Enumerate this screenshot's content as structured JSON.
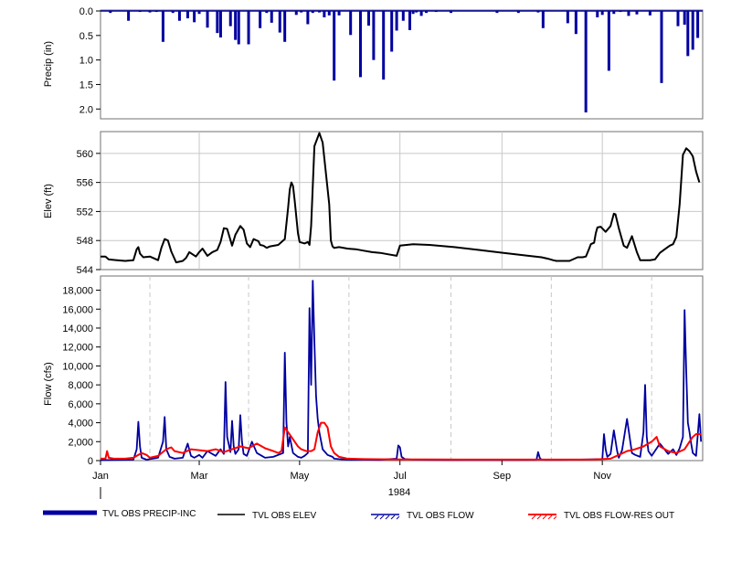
{
  "chart_data": [
    {
      "type": "bar",
      "ylabel": "Precip (in)",
      "ylim": [
        0,
        2.2
      ],
      "y_inverted": true,
      "yticks": [
        "0.0",
        "0.5",
        "1.0",
        "1.5",
        "2.0"
      ],
      "ytick_values": [
        0,
        0.5,
        1.0,
        1.5,
        2.0
      ],
      "grid": false,
      "series": [
        {
          "color": "#0000a0",
          "x_day": [
            6,
            17,
            24,
            30,
            34,
            38,
            44,
            48,
            53,
            57,
            60,
            65,
            71,
            73,
            79,
            82,
            84,
            90,
            97,
            101,
            104,
            109,
            112,
            119,
            122,
            126,
            129,
            133,
            136,
            139,
            142,
            145,
            152,
            158,
            163,
            166,
            172,
            177,
            180,
            184,
            188,
            190,
            192,
            195,
            198,
            204,
            213,
            241,
            254,
            266,
            269,
            284,
            289,
            295,
            302,
            305,
            309,
            312,
            316,
            321,
            326,
            334,
            341,
            351,
            355,
            357,
            360,
            363
          ],
          "values": [
            0.04,
            0.2,
            0.02,
            0.03,
            0.02,
            0.63,
            0.04,
            0.2,
            0.15,
            0.23,
            0.06,
            0.34,
            0.45,
            0.54,
            0.31,
            0.59,
            0.68,
            0.68,
            0.35,
            0.04,
            0.24,
            0.44,
            0.63,
            0.08,
            0.03,
            0.27,
            0.04,
            0.03,
            0.13,
            0.09,
            1.42,
            0.09,
            0.49,
            1.35,
            0.3,
            1.0,
            1.4,
            0.83,
            0.4,
            0.2,
            0.39,
            0.06,
            0.03,
            0.1,
            0.04,
            0.02,
            0.04,
            0.04,
            0.04,
            0.03,
            0.35,
            0.25,
            0.47,
            2.07,
            0.13,
            0.08,
            1.22,
            0.06,
            0.02,
            0.1,
            0.07,
            0.09,
            1.47,
            0.31,
            0.28,
            0.92,
            0.79,
            0.55
          ]
        }
      ]
    },
    {
      "type": "line",
      "ylabel": "Elev (ft)",
      "ylim": [
        544,
        563
      ],
      "yticks": [
        "544",
        "548",
        "552",
        "556",
        "560"
      ],
      "ytick_values": [
        544,
        548,
        552,
        556,
        560
      ],
      "grid": true,
      "series": [
        {
          "color": "#000000",
          "x_day": [
            0,
            3,
            5,
            10,
            15,
            20,
            22,
            23,
            24,
            26,
            30,
            35,
            37,
            39,
            41,
            43,
            46,
            50,
            52,
            54,
            58,
            60,
            62,
            65,
            68,
            71,
            73,
            75,
            77,
            80,
            82,
            85,
            87,
            89,
            91,
            93,
            96,
            97,
            99,
            101,
            103,
            108,
            112,
            114,
            115,
            116,
            117,
            118,
            120,
            121,
            124,
            126,
            127,
            128,
            130,
            133,
            135,
            139,
            140,
            141,
            142,
            145,
            150,
            155,
            160,
            165,
            170,
            175,
            180,
            182,
            190,
            200,
            215,
            230,
            245,
            260,
            268,
            272,
            275,
            277,
            280,
            285,
            290,
            293,
            295,
            297,
            298,
            300,
            301,
            302,
            304,
            307,
            310,
            312,
            313,
            315,
            318,
            320,
            323,
            326,
            328,
            330,
            332,
            334,
            337,
            340,
            343,
            346,
            348,
            350,
            352,
            354,
            356,
            358,
            360,
            362,
            364
          ],
          "values": [
            545.8,
            545.8,
            545.4,
            545.3,
            545.2,
            545.3,
            546.8,
            547.1,
            546.2,
            545.7,
            545.8,
            545.3,
            547.0,
            548.2,
            548.0,
            546.5,
            545.0,
            545.2,
            545.6,
            546.4,
            545.8,
            546.4,
            546.9,
            545.9,
            546.4,
            546.7,
            547.8,
            549.7,
            549.6,
            547.3,
            548.8,
            550.0,
            549.5,
            547.6,
            547.1,
            548.2,
            547.9,
            547.4,
            547.3,
            547.0,
            547.2,
            547.4,
            548.2,
            552.5,
            555.0,
            556.0,
            555.5,
            553.5,
            549.0,
            547.8,
            547.6,
            547.8,
            547.4,
            550.0,
            561.0,
            562.8,
            561.5,
            553.0,
            548.0,
            547.2,
            547.0,
            547.1,
            546.9,
            546.8,
            546.6,
            546.4,
            546.3,
            546.1,
            545.9,
            547.3,
            547.5,
            547.4,
            547.1,
            546.7,
            546.3,
            545.9,
            545.7,
            545.5,
            545.3,
            545.2,
            545.2,
            545.2,
            545.7,
            545.7,
            545.8,
            546.9,
            547.5,
            547.7,
            549.0,
            549.8,
            549.9,
            549.2,
            550.0,
            551.7,
            551.6,
            549.7,
            547.3,
            547.0,
            548.6,
            546.4,
            545.3,
            545.3,
            545.3,
            545.3,
            545.4,
            546.3,
            546.8,
            547.3,
            547.5,
            548.5,
            553.0,
            559.8,
            560.7,
            560.3,
            559.6,
            557.5,
            556.0
          ]
        }
      ]
    },
    {
      "type": "line",
      "xlabel": "1984",
      "ylabel": "Flow (cfs)",
      "ylim": [
        0,
        19500
      ],
      "yticks": [
        "0",
        "2,000",
        "4,000",
        "6,000",
        "8,000",
        "10,000",
        "12,000",
        "14,000",
        "16,000",
        "18,000"
      ],
      "ytick_values": [
        0,
        2000,
        4000,
        6000,
        8000,
        10000,
        12000,
        14000,
        16000,
        18000
      ],
      "xticks": [
        "Jan",
        "Mar",
        "May",
        "Jul",
        "Sep",
        "Nov"
      ],
      "xtick_days": [
        0,
        60,
        121,
        182,
        244,
        305
      ],
      "grid_days": [
        30,
        90,
        151,
        213,
        274,
        335
      ],
      "x_range_days": [
        0,
        365
      ],
      "legend_position": "bottom",
      "series": [
        {
          "name": "TVL OBS FLOW",
          "color": "#0000a0",
          "x_day": [
            0,
            20,
            22,
            23,
            24,
            25,
            28,
            35,
            38,
            39,
            40,
            42,
            45,
            50,
            53,
            55,
            57,
            60,
            62,
            65,
            70,
            73,
            75,
            76,
            77,
            79,
            80,
            81,
            82,
            84,
            85,
            86,
            87,
            89,
            92,
            95,
            98,
            100,
            105,
            111,
            112,
            113,
            114,
            115,
            117,
            120,
            122,
            124,
            126,
            127,
            128,
            129,
            130,
            131,
            132,
            133,
            135,
            138,
            141,
            142,
            145,
            150,
            160,
            170,
            180,
            181,
            182,
            183,
            185,
            190,
            200,
            210,
            220,
            230,
            240,
            265,
            266,
            267,
            268,
            270,
            280,
            290,
            295,
            305,
            306,
            307,
            308,
            310,
            312,
            314,
            315,
            317,
            320,
            322,
            323,
            325,
            328,
            330,
            331,
            332,
            333,
            335,
            340,
            345,
            348,
            350,
            352,
            354,
            355,
            356,
            357,
            358,
            359,
            360,
            362,
            364,
            365
          ],
          "values": [
            50,
            100,
            1200,
            4100,
            1500,
            300,
            100,
            300,
            2000,
            4600,
            1200,
            400,
            200,
            300,
            1800,
            500,
            300,
            600,
            300,
            1000,
            500,
            1200,
            700,
            8300,
            2500,
            900,
            4200,
            1500,
            700,
            1200,
            4800,
            2000,
            700,
            500,
            2000,
            800,
            500,
            300,
            400,
            800,
            11400,
            4000,
            1500,
            2500,
            800,
            400,
            300,
            500,
            800,
            16100,
            8000,
            19000,
            12500,
            6800,
            4400,
            3000,
            1200,
            600,
            400,
            200,
            150,
            100,
            100,
            80,
            200,
            1600,
            1400,
            400,
            150,
            100,
            80,
            70,
            60,
            60,
            60,
            80,
            900,
            300,
            100,
            80,
            80,
            100,
            120,
            150,
            2800,
            1200,
            400,
            700,
            3200,
            1000,
            300,
            1100,
            4400,
            2000,
            800,
            600,
            400,
            3000,
            8000,
            2500,
            1000,
            500,
            1800,
            700,
            1200,
            600,
            1300,
            2500,
            15900,
            9500,
            4000,
            3000,
            1800,
            800,
            500,
            4900,
            2000
          ]
        },
        {
          "name": "TVL OBS FLOW-RES OUT",
          "color": "#ff0000",
          "x_day": [
            0,
            3,
            4,
            5,
            8,
            15,
            20,
            25,
            28,
            30,
            35,
            40,
            43,
            45,
            50,
            55,
            60,
            65,
            70,
            75,
            80,
            85,
            90,
            95,
            100,
            105,
            108,
            110,
            112,
            114,
            116,
            118,
            120,
            122,
            125,
            128,
            130,
            132,
            134,
            136,
            138,
            140,
            142,
            145,
            150,
            160,
            180,
            200,
            220,
            240,
            260,
            280,
            300,
            305,
            310,
            315,
            320,
            325,
            330,
            335,
            338,
            340,
            345,
            350,
            355,
            358,
            360,
            362,
            365
          ],
          "values": [
            200,
            200,
            1000,
            300,
            200,
            200,
            300,
            800,
            600,
            300,
            500,
            1200,
            1400,
            1000,
            800,
            1200,
            1100,
            1000,
            1200,
            900,
            1200,
            1500,
            1300,
            1800,
            1300,
            1000,
            800,
            1000,
            3500,
            3000,
            2500,
            2000,
            1500,
            1200,
            1000,
            1000,
            1200,
            3000,
            4000,
            4000,
            3500,
            1500,
            800,
            400,
            200,
            150,
            130,
            120,
            110,
            110,
            110,
            110,
            120,
            150,
            200,
            600,
            1000,
            1200,
            1500,
            2000,
            2500,
            1500,
            1000,
            800,
            1200,
            2000,
            2500,
            2800,
            2800
          ]
        }
      ]
    }
  ],
  "legend": [
    {
      "label": "TVL OBS PRECIP-INC",
      "color": "#0000a0",
      "style": "thick"
    },
    {
      "label": "TVL OBS ELEV",
      "color": "#000000",
      "style": "line"
    },
    {
      "label": "TVL OBS FLOW",
      "color": "#0000a0",
      "style": "hatched"
    },
    {
      "label": "TVL OBS FLOW-RES OUT",
      "color": "#ff0000",
      "style": "hatched"
    }
  ]
}
